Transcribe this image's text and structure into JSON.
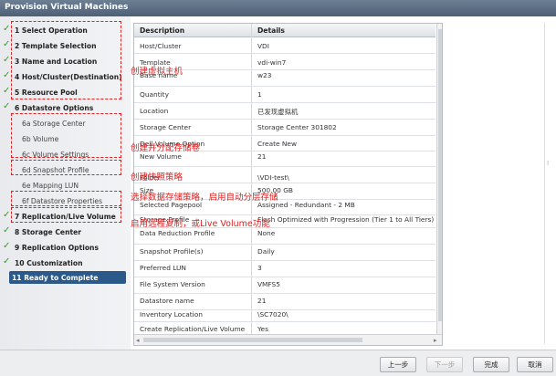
{
  "window": {
    "title": "Provision Virtual Machines"
  },
  "steps": [
    {
      "label": "1  Select Operation",
      "checked": true,
      "kind": "main"
    },
    {
      "label": "2  Template Selection",
      "checked": true,
      "kind": "main"
    },
    {
      "label": "3  Name and Location",
      "checked": true,
      "kind": "main"
    },
    {
      "label": "4  Host/Cluster(Destination)",
      "checked": true,
      "kind": "main"
    },
    {
      "label": "5  Resource Pool",
      "checked": true,
      "kind": "main"
    },
    {
      "label": "6  Datastore Options",
      "checked": true,
      "kind": "main"
    },
    {
      "label": "6a  Storage Center",
      "checked": false,
      "kind": "sub"
    },
    {
      "label": "6b  Volume",
      "checked": false,
      "kind": "sub"
    },
    {
      "label": "6c  Volume Settings",
      "checked": false,
      "kind": "sub"
    },
    {
      "label": "6d  Snapshot Profile",
      "checked": false,
      "kind": "sub"
    },
    {
      "label": "6e  Mapping LUN",
      "checked": false,
      "kind": "sub"
    },
    {
      "label": "6f  Datastore Properties",
      "checked": false,
      "kind": "sub"
    },
    {
      "label": "7  Replication/Live Volume",
      "checked": true,
      "kind": "main"
    },
    {
      "label": "8  Storage Center",
      "checked": true,
      "kind": "main"
    },
    {
      "label": "9  Replication Options",
      "checked": true,
      "kind": "main"
    },
    {
      "label": "10  Customization",
      "checked": true,
      "kind": "main"
    },
    {
      "label": "11  Ready to Complete",
      "checked": false,
      "kind": "active"
    }
  ],
  "annotations": [
    "创建虚拟主机",
    "创建并分配存储卷",
    "创建快照策略",
    "选择数据存储策略，启用自动分层存储",
    "启用远程复制，或Live Volume功能"
  ],
  "table": {
    "headers": [
      "Description",
      "Details"
    ],
    "rows": [
      [
        "Host/Cluster",
        "VDI"
      ],
      [
        "Template",
        "vdi-win7"
      ],
      [
        "Base name",
        "w23"
      ],
      [
        "Quantity",
        "1"
      ],
      [
        "Location",
        "已发现虚拟机"
      ],
      [
        "Storage Center",
        "Storage Center 301802"
      ],
      [
        "Dell Volume Option",
        "Create New"
      ],
      [
        "New Volume",
        "21"
      ],
      [
        "Folder",
        "\\VDI-test\\"
      ],
      [
        "Size",
        "500.00 GB"
      ],
      [
        "Selected Pagepool",
        "Assigned - Redundant - 2 MB"
      ],
      [
        "Storage Profile",
        "Flash Optimized with Progression (Tier 1 to All Tiers)"
      ],
      [
        "Data Reduction Profile",
        "None"
      ],
      [
        "Snapshot Profile(s)",
        "Daily"
      ],
      [
        "Preferred LUN",
        "3"
      ],
      [
        "File System Version",
        "VMFS5"
      ],
      [
        "Datastore name",
        "21"
      ],
      [
        "Inventory Location",
        "\\SC7020\\"
      ],
      [
        "Create Replication/Live Volume",
        "Yes"
      ]
    ]
  },
  "footer": {
    "back": "上一步",
    "next": "下一步",
    "finish": "完成",
    "cancel": "取消"
  },
  "colors": {
    "annotation": "#e02020",
    "active_step": "#2b5a8a",
    "check": "#3a9a2a"
  }
}
